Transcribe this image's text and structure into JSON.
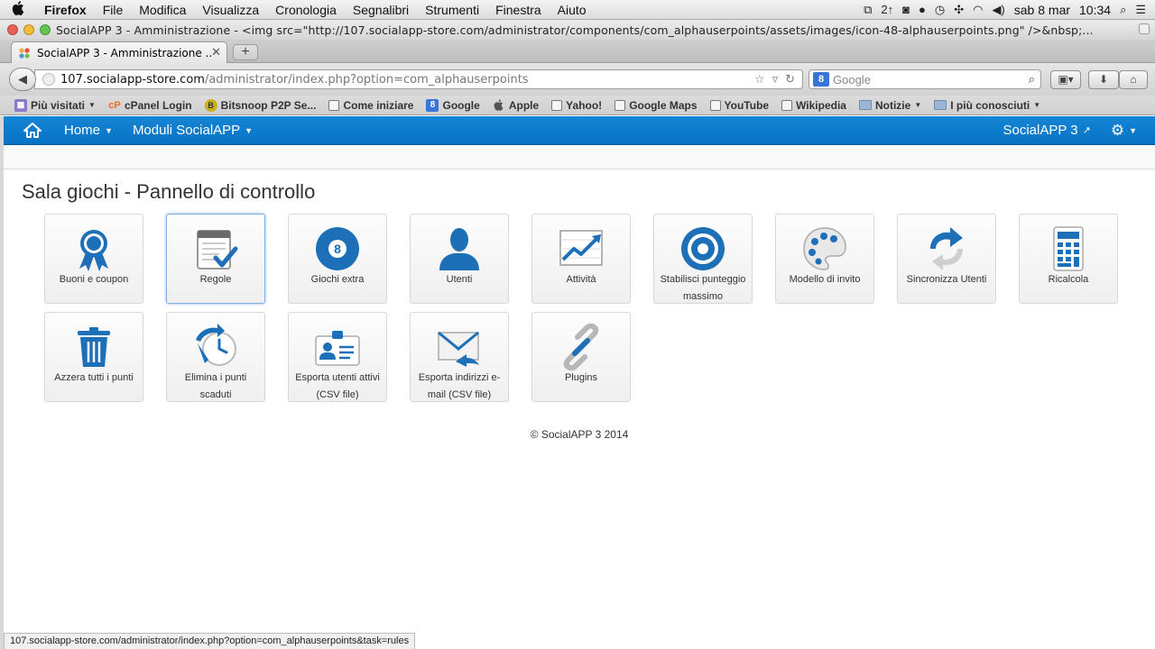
{
  "menubar": {
    "app": "Firefox",
    "items": [
      "File",
      "Modifica",
      "Visualizza",
      "Cronologia",
      "Segnalibri",
      "Strumenti",
      "Finestra",
      "Aiuto"
    ],
    "day_date": "sab 8 mar",
    "time": "10:34",
    "badge": "2↑"
  },
  "window": {
    "title": "SocialAPP 3 - Amministrazione - <img src=\"http://107.socialapp-store.com/administrator/components/com_alphauserpoints/assets/images/icon-48-alphauserpoints.png\" />&nbsp;..."
  },
  "tab": {
    "label": "SocialAPP 3 - Amministrazione ...",
    "new_tab": "+"
  },
  "urlbar": {
    "domain": "107.socialapp-store.com",
    "path": "/administrator/index.php?option=com_alphauserpoints"
  },
  "search": {
    "placeholder": "Google",
    "badge": "8"
  },
  "bookmarks": [
    {
      "label": "Più visitati",
      "icon": "most-visited-icon"
    },
    {
      "label": "cPanel Login",
      "icon": "cpanel-icon"
    },
    {
      "label": "Bitsnoop P2P Se...",
      "icon": "bitsnoop-icon"
    },
    {
      "label": "Come iniziare",
      "icon": "page-icon"
    },
    {
      "label": "Google",
      "icon": "google-icon"
    },
    {
      "label": "Apple",
      "icon": "apple-icon"
    },
    {
      "label": "Yahoo!",
      "icon": "page-icon"
    },
    {
      "label": "Google Maps",
      "icon": "page-icon"
    },
    {
      "label": "YouTube",
      "icon": "page-icon"
    },
    {
      "label": "Wikipedia",
      "icon": "page-icon"
    },
    {
      "label": "Notizie",
      "icon": "folder-icon"
    },
    {
      "label": "I più conosciuti",
      "icon": "folder-icon"
    }
  ],
  "appnav": {
    "home": "Home",
    "modules": "Moduli SocialAPP",
    "site": "SocialAPP 3"
  },
  "page": {
    "title": "Sala giochi - Pannello di controllo"
  },
  "tiles_row1": [
    {
      "label": "Buoni e coupon",
      "icon": "award-ribbon-icon"
    },
    {
      "label": "Regole",
      "icon": "checklist-icon"
    },
    {
      "label": "Giochi extra",
      "icon": "eight-ball-icon"
    },
    {
      "label": "Utenti",
      "icon": "user-icon"
    },
    {
      "label": "Attività",
      "icon": "activity-chart-icon"
    },
    {
      "label": "Stabilisci punteggio massimo",
      "icon": "target-icon"
    },
    {
      "label": "Modello di invito",
      "icon": "palette-icon"
    },
    {
      "label": "Sincronizza Utenti",
      "icon": "sync-arrows-icon"
    },
    {
      "label": "Ricalcola",
      "icon": "calculator-icon"
    }
  ],
  "tiles_row2": [
    {
      "label": "Azzera tutti i punti",
      "icon": "trash-icon"
    },
    {
      "label": "Elimina i punti scaduti",
      "icon": "expired-clock-icon"
    },
    {
      "label": "Esporta utenti attivi (CSV file)",
      "icon": "id-card-icon"
    },
    {
      "label": "Esporta indirizzi e-mail (CSV file)",
      "icon": "envelope-icon"
    },
    {
      "label": "Plugins",
      "icon": "link-icon"
    }
  ],
  "footer": "© SocialAPP 3 2014",
  "status_url": "107.socialapp-store.com/administrator/index.php?option=com_alphauserpoints&task=rules",
  "colors": {
    "nav_blue": "#0b7bcc",
    "icon_blue": "#1d6fb8"
  }
}
